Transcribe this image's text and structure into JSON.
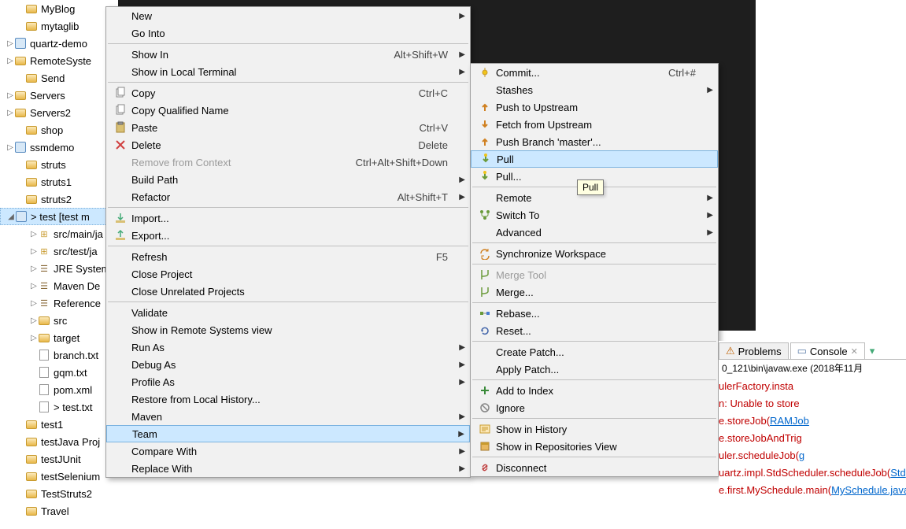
{
  "tree": [
    {
      "label": "MyBlog",
      "lvl": 1,
      "icon": "folder"
    },
    {
      "label": "mytaglib",
      "lvl": 1,
      "icon": "folder"
    },
    {
      "label": "quartz-demo",
      "lvl": 0,
      "icon": "proj",
      "arrow": ">"
    },
    {
      "label": "RemoteSyste",
      "lvl": 0,
      "icon": "folder",
      "arrow": ">"
    },
    {
      "label": "Send",
      "lvl": 1,
      "icon": "folder"
    },
    {
      "label": "Servers",
      "lvl": 0,
      "icon": "folder",
      "arrow": ">"
    },
    {
      "label": "Servers2",
      "lvl": 0,
      "icon": "folder",
      "arrow": ">"
    },
    {
      "label": "shop",
      "lvl": 1,
      "icon": "folder"
    },
    {
      "label": "ssmdemo",
      "lvl": 0,
      "icon": "proj",
      "arrow": ">"
    },
    {
      "label": "struts",
      "lvl": 1,
      "icon": "folder"
    },
    {
      "label": "struts1",
      "lvl": 1,
      "icon": "folder"
    },
    {
      "label": "struts2",
      "lvl": 1,
      "icon": "folder"
    },
    {
      "label": "> test [test m",
      "lvl": 0,
      "icon": "proj",
      "arrow": "v",
      "sel": true
    },
    {
      "label": "src/main/ja",
      "lvl": 2,
      "icon": "pkg",
      "arrow": ">"
    },
    {
      "label": "src/test/ja",
      "lvl": 2,
      "icon": "pkg",
      "arrow": ">"
    },
    {
      "label": "JRE System",
      "lvl": 2,
      "icon": "lib",
      "arrow": ">"
    },
    {
      "label": "Maven De",
      "lvl": 2,
      "icon": "lib",
      "arrow": ">"
    },
    {
      "label": "Reference",
      "lvl": 2,
      "icon": "lib",
      "arrow": ">"
    },
    {
      "label": "src",
      "lvl": 2,
      "icon": "folder",
      "arrow": ">"
    },
    {
      "label": "target",
      "lvl": 2,
      "icon": "folder",
      "arrow": ">"
    },
    {
      "label": "branch.txt",
      "lvl": 2,
      "icon": "file"
    },
    {
      "label": "gqm.txt",
      "lvl": 2,
      "icon": "file"
    },
    {
      "label": "pom.xml",
      "lvl": 2,
      "icon": "file"
    },
    {
      "label": "> test.txt",
      "lvl": 2,
      "icon": "file"
    },
    {
      "label": "test1",
      "lvl": 1,
      "icon": "folder"
    },
    {
      "label": "testJava Proj",
      "lvl": 1,
      "icon": "folder"
    },
    {
      "label": "testJUnit",
      "lvl": 1,
      "icon": "folder"
    },
    {
      "label": "testSelenium",
      "lvl": 1,
      "icon": "folder"
    },
    {
      "label": "TestStruts2",
      "lvl": 1,
      "icon": "folder"
    },
    {
      "label": "Travel",
      "lvl": 1,
      "icon": "folder"
    }
  ],
  "menu1": [
    {
      "t": "item",
      "label": "New",
      "sub": true
    },
    {
      "t": "item",
      "label": "Go Into"
    },
    {
      "t": "sep"
    },
    {
      "t": "item",
      "label": "Show In",
      "right": "Alt+Shift+W",
      "sub": true
    },
    {
      "t": "item",
      "label": "Show in Local Terminal",
      "sub": true
    },
    {
      "t": "sep"
    },
    {
      "t": "item",
      "label": "Copy",
      "right": "Ctrl+C",
      "icon": "copy"
    },
    {
      "t": "item",
      "label": "Copy Qualified Name",
      "icon": "copy"
    },
    {
      "t": "item",
      "label": "Paste",
      "right": "Ctrl+V",
      "icon": "paste"
    },
    {
      "t": "item",
      "label": "Delete",
      "right": "Delete",
      "icon": "delete"
    },
    {
      "t": "item",
      "label": "Remove from Context",
      "right": "Ctrl+Alt+Shift+Down",
      "dis": true
    },
    {
      "t": "item",
      "label": "Build Path",
      "sub": true
    },
    {
      "t": "item",
      "label": "Refactor",
      "right": "Alt+Shift+T",
      "sub": true
    },
    {
      "t": "sep"
    },
    {
      "t": "item",
      "label": "Import...",
      "icon": "import"
    },
    {
      "t": "item",
      "label": "Export...",
      "icon": "export"
    },
    {
      "t": "sep"
    },
    {
      "t": "item",
      "label": "Refresh",
      "right": "F5"
    },
    {
      "t": "item",
      "label": "Close Project"
    },
    {
      "t": "item",
      "label": "Close Unrelated Projects"
    },
    {
      "t": "sep"
    },
    {
      "t": "item",
      "label": "Validate"
    },
    {
      "t": "item",
      "label": "Show in Remote Systems view"
    },
    {
      "t": "item",
      "label": "Run As",
      "sub": true
    },
    {
      "t": "item",
      "label": "Debug As",
      "sub": true
    },
    {
      "t": "item",
      "label": "Profile As",
      "sub": true
    },
    {
      "t": "item",
      "label": "Restore from Local History..."
    },
    {
      "t": "item",
      "label": "Maven",
      "sub": true
    },
    {
      "t": "item",
      "label": "Team",
      "sub": true,
      "hl": true
    },
    {
      "t": "item",
      "label": "Compare With",
      "sub": true
    },
    {
      "t": "item",
      "label": "Replace With",
      "sub": true
    }
  ],
  "menu2": [
    {
      "t": "item",
      "label": "Commit...",
      "right": "Ctrl+#",
      "icon": "commit"
    },
    {
      "t": "item",
      "label": "Stashes",
      "sub": true
    },
    {
      "t": "item",
      "label": "Push to Upstream",
      "icon": "push"
    },
    {
      "t": "item",
      "label": "Fetch from Upstream",
      "icon": "fetch"
    },
    {
      "t": "item",
      "label": "Push Branch 'master'...",
      "icon": "push"
    },
    {
      "t": "item",
      "label": "Pull",
      "icon": "pull",
      "hl": true
    },
    {
      "t": "item",
      "label": "Pull...",
      "icon": "pull"
    },
    {
      "t": "sep"
    },
    {
      "t": "item",
      "label": "Remote",
      "sub": true
    },
    {
      "t": "item",
      "label": "Switch To",
      "sub": true,
      "icon": "branch"
    },
    {
      "t": "item",
      "label": "Advanced",
      "sub": true
    },
    {
      "t": "sep"
    },
    {
      "t": "item",
      "label": "Synchronize Workspace",
      "icon": "sync"
    },
    {
      "t": "sep"
    },
    {
      "t": "item",
      "label": "Merge Tool",
      "dis": true,
      "icon": "merge"
    },
    {
      "t": "item",
      "label": "Merge...",
      "icon": "merge"
    },
    {
      "t": "sep"
    },
    {
      "t": "item",
      "label": "Rebase...",
      "icon": "rebase"
    },
    {
      "t": "item",
      "label": "Reset...",
      "icon": "reset"
    },
    {
      "t": "sep"
    },
    {
      "t": "item",
      "label": "Create Patch..."
    },
    {
      "t": "item",
      "label": "Apply Patch..."
    },
    {
      "t": "sep"
    },
    {
      "t": "item",
      "label": "Add to Index",
      "icon": "add"
    },
    {
      "t": "item",
      "label": "Ignore",
      "icon": "ignore"
    },
    {
      "t": "sep"
    },
    {
      "t": "item",
      "label": "Show in History",
      "icon": "history"
    },
    {
      "t": "item",
      "label": "Show in Repositories View",
      "icon": "repo"
    },
    {
      "t": "sep"
    },
    {
      "t": "item",
      "label": "Disconnect",
      "icon": "disconnect"
    }
  ],
  "tooltip": "Pull",
  "tabs": {
    "problems": "Problems",
    "console": "Console"
  },
  "console_path": "0_121\\bin\\javaw.exe (2018年11月",
  "console_lines": [
    {
      "segs": [
        {
          "c": "cr",
          "t": "ulerFactory.insta"
        }
      ]
    },
    {
      "segs": [
        {
          "c": "cr",
          "t": "n: Unable to store"
        }
      ]
    },
    {
      "segs": [
        {
          "c": "cr",
          "t": "e.storeJob("
        },
        {
          "c": "cb",
          "t": "RAMJob"
        }
      ]
    },
    {
      "segs": [
        {
          "c": "cr",
          "t": "e.storeJobAndTrig"
        }
      ]
    },
    {
      "segs": [
        {
          "c": "cr",
          "t": "uler.scheduleJob("
        },
        {
          "c": "cb",
          "t": "g"
        }
      ]
    },
    {
      "segs": [
        {
          "c": "cr",
          "t": "uartz.impl.StdScheduler.scheduleJob("
        },
        {
          "c": "cb",
          "t": "Std"
        }
      ]
    },
    {
      "segs": [
        {
          "c": "cr",
          "t": "e.first.MySchedule.main("
        },
        {
          "c": "cb",
          "t": "MySchedule.java"
        }
      ]
    }
  ]
}
